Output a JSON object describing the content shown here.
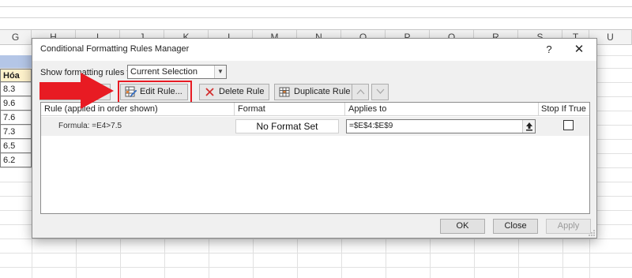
{
  "spreadsheet": {
    "columns": [
      "G",
      "H",
      "I",
      "J",
      "K",
      "L",
      "M",
      "N",
      "O",
      "P",
      "Q",
      "R",
      "S",
      "T",
      "U"
    ],
    "header_cell": "Hóa",
    "values": [
      "8.3",
      "9.6",
      "7.6",
      "7.3",
      "6.5",
      "6.2"
    ],
    "colors": {
      "band": "#b4c6e7",
      "header_fill": "#fff2cc"
    }
  },
  "dialog": {
    "title": "Conditional Formatting Rules Manager",
    "help_label": "?",
    "close_label": "✕",
    "show_rules_label": "Show formatting rules for:",
    "show_rules_value": "Current Selection",
    "toolbar": {
      "edit_rule": "Edit Rule...",
      "delete_rule": "Delete Rule",
      "duplicate_rule": "Duplicate Rule"
    },
    "columns": {
      "rule": "Rule (applied in order shown)",
      "format": "Format",
      "applies_to": "Applies to",
      "stop_if_true": "Stop If True"
    },
    "rules": [
      {
        "rule": "Formula: =E4>7.5",
        "format": "No Format Set",
        "applies_to": "=$E$4:$E$9",
        "stop_if_true": false
      }
    ],
    "buttons": {
      "ok": "OK",
      "close": "Close",
      "apply": "Apply"
    }
  },
  "annotation": {
    "color": "#e81b23",
    "icon": "red-arrow-icon"
  }
}
